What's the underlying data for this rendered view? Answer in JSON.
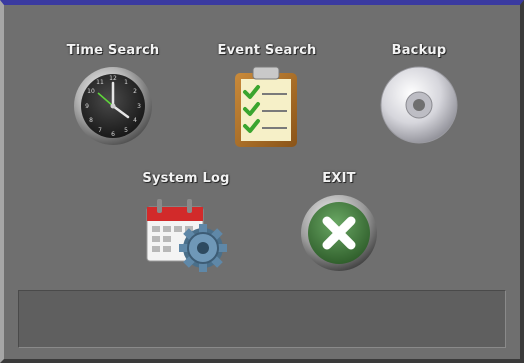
{
  "menu": {
    "time_search": {
      "label": "Time Search",
      "icon": "clock-icon"
    },
    "event_search": {
      "label": "Event Search",
      "icon": "checklist-icon"
    },
    "backup": {
      "label": "Backup",
      "icon": "disc-icon"
    },
    "system_log": {
      "label": "System Log",
      "icon": "calendar-gear-icon"
    },
    "exit": {
      "label": "EXIT",
      "icon": "close-icon"
    }
  },
  "status_bar": {
    "text": ""
  },
  "colors": {
    "background": "#6f6f6f",
    "exit_green": "#3f7a3a",
    "check_green": "#3aa52e",
    "calendar_red": "#d22a2a"
  }
}
